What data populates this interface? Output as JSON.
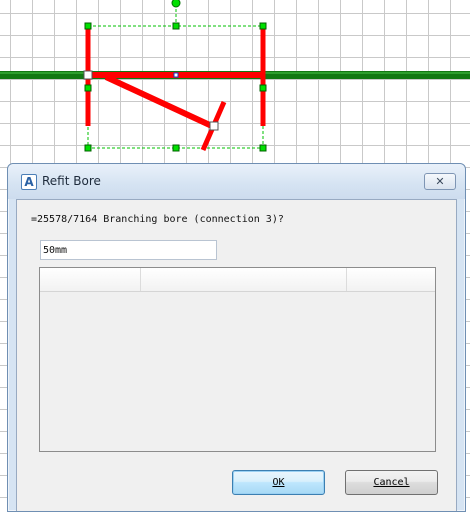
{
  "dialog": {
    "title": "Refit Bore",
    "app_icon_glyph": "A",
    "close_glyph": "✕",
    "prompt": "=25578/7164 Branching bore (connection 3)?",
    "input_value": "50mm",
    "list_columns": [
      "",
      "",
      ""
    ],
    "ok_label": "OK",
    "cancel_label": "Cancel"
  },
  "colors": {
    "pipe_green": "#127812",
    "bore_red": "#ff0000",
    "handle_green": "#00e000",
    "dialog_frame": "#d6e4f3",
    "client_bg": "#f0f0f0",
    "default_button": "#3c7fb1"
  }
}
